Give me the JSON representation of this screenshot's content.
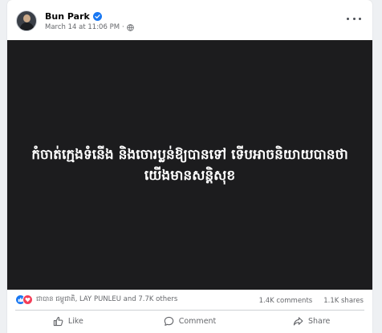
{
  "post": {
    "author": "Bun Park",
    "timestamp": "March 14 at 11:06 PM",
    "separator": "·",
    "audience_icon": "globe-icon",
    "verified_icon": "verified-badge-icon",
    "more_icon": "more-options-icon",
    "media_text": "កំចាត់ក្មេងទំនើង និងចោរប្លន់ឱ្យបានទៅ ទើបអាចនិយាយបានថា យើងមានសន្តិសុខ"
  },
  "stats": {
    "reaction_icons": [
      "like-icon",
      "love-icon"
    ],
    "reaction_names": "ជាបាន ជម្ពូជាតិ, LAY PUNLEU and 7.7K others",
    "comments": "1.4K comments",
    "shares": "1.1K shares"
  },
  "actions": {
    "like_label": "Like",
    "comment_label": "Comment",
    "share_label": "Share"
  },
  "colors": {
    "accent": "#1877f2",
    "love": "#f33e58",
    "media_bg": "#1c1c1e"
  }
}
